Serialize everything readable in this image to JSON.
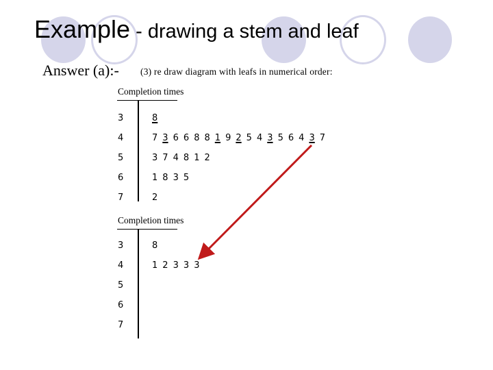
{
  "slide": {
    "title_main": "Example",
    "title_rest": " - drawing a stem and leaf",
    "answer_label": "Answer (a):-",
    "instruction": "(3)  re draw diagram with leafs in numerical order:"
  },
  "decoration": {
    "accent_color": "#d5d5ea",
    "arrow_color": "#c01a1a"
  },
  "plot_original": {
    "caption": "Completion times",
    "rows": [
      {
        "stem": "3",
        "leaves": [
          {
            "v": "8",
            "marked": true
          }
        ]
      },
      {
        "stem": "4",
        "leaves": [
          {
            "v": "7",
            "marked": false
          },
          {
            "v": "3",
            "marked": true
          },
          {
            "v": "6",
            "marked": false
          },
          {
            "v": "6",
            "marked": false
          },
          {
            "v": "8",
            "marked": false
          },
          {
            "v": "8",
            "marked": false
          },
          {
            "v": "1",
            "marked": true
          },
          {
            "v": "9",
            "marked": false
          },
          {
            "v": "2",
            "marked": true
          },
          {
            "v": "5",
            "marked": false
          },
          {
            "v": "4",
            "marked": false
          },
          {
            "v": "3",
            "marked": true
          },
          {
            "v": "5",
            "marked": false
          },
          {
            "v": "6",
            "marked": false
          },
          {
            "v": "4",
            "marked": false
          },
          {
            "v": "3",
            "marked": true
          },
          {
            "v": "7",
            "marked": false
          }
        ]
      },
      {
        "stem": "5",
        "leaves": [
          {
            "v": "3",
            "marked": false
          },
          {
            "v": "7",
            "marked": false
          },
          {
            "v": "4",
            "marked": false
          },
          {
            "v": "8",
            "marked": false
          },
          {
            "v": "1",
            "marked": false
          },
          {
            "v": "2",
            "marked": false
          }
        ]
      },
      {
        "stem": "6",
        "leaves": [
          {
            "v": "1",
            "marked": false
          },
          {
            "v": "8",
            "marked": false
          },
          {
            "v": "3",
            "marked": false
          },
          {
            "v": "5",
            "marked": false
          }
        ]
      },
      {
        "stem": "7",
        "leaves": [
          {
            "v": "2",
            "marked": false
          }
        ]
      }
    ]
  },
  "plot_ordered": {
    "caption": "Completion times",
    "rows": [
      {
        "stem": "3",
        "leaves": [
          {
            "v": "8",
            "marked": false
          }
        ]
      },
      {
        "stem": "4",
        "leaves": [
          {
            "v": "1",
            "marked": false
          },
          {
            "v": "2",
            "marked": false
          },
          {
            "v": "3",
            "marked": false
          },
          {
            "v": "3",
            "marked": false
          },
          {
            "v": "3",
            "marked": false
          }
        ]
      },
      {
        "stem": "5",
        "leaves": []
      },
      {
        "stem": "6",
        "leaves": []
      },
      {
        "stem": "7",
        "leaves": []
      }
    ]
  }
}
